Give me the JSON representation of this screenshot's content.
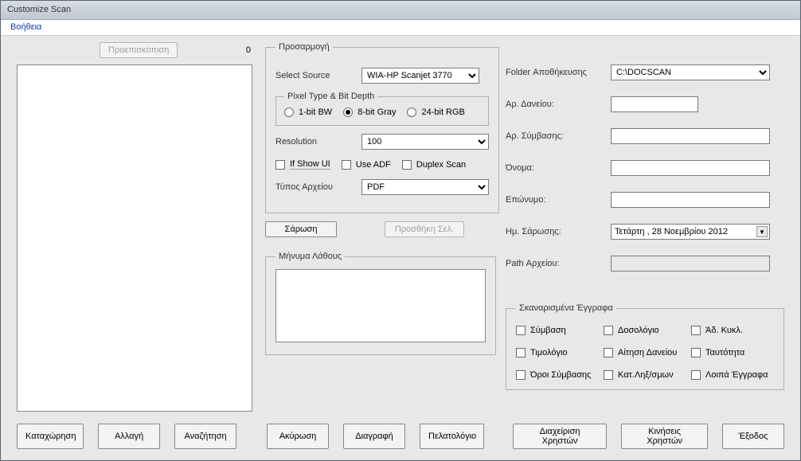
{
  "window": {
    "title": "Customize Scan"
  },
  "menu": {
    "help": "Βοήθεια"
  },
  "left": {
    "preview_btn": "Προεπισκόπιση",
    "page_count": "0"
  },
  "adjust": {
    "legend": "Προσαρμογή",
    "select_source_label": "Select Source",
    "select_source_value": "WIA-HP Scanjet 3770",
    "pixel_legend": "Pixel Type & Bit Depth",
    "radio_bw": "1-bit BW",
    "radio_gray": "8-bit Gray",
    "radio_rgb": "24-bit RGB",
    "resolution_label": "Resolution",
    "resolution_value": "100",
    "if_show_ui": "If Show UI",
    "use_adf": "Use ADF",
    "duplex": "Duplex Scan",
    "file_type_label": "Τύπος Αρχείου",
    "file_type_value": "PDF"
  },
  "actions": {
    "scan": "Σάρωση",
    "add_page": "Προσθήκη Σελ."
  },
  "error_msg": {
    "legend": "Μήνυμα Λάθους"
  },
  "right_form": {
    "folder_label": "Folder Αποθήκευσης",
    "folder_value": "C:\\DOCSCAN",
    "loan_no_label": "Αρ. Δανείου:",
    "contract_no_label": "Αρ. Σύμβασης:",
    "first_name_label": "Όνομα:",
    "last_name_label": "Επώνυμο:",
    "scan_date_label": "Ημ. Σάρωσης:",
    "scan_date_value": "Τετάρτη , 28  Νοεμβρίου  2012",
    "file_path_label": "Path Αρχείου:"
  },
  "scanned_docs": {
    "legend": "Σκαναρισμένα Έγγραφα",
    "items": {
      "0": "Σύμβαση",
      "1": "Δοσολόγιο",
      "2": "Άδ. Κυκλ.",
      "3": "Τιμολόγιο",
      "4": "Αίτηση Δανείου",
      "5": "Ταυτότητα",
      "6": "Όροι Σύμβασης",
      "7": "Κατ.Ληξ/σμων",
      "8": "Λοιπά Έγγραφα"
    }
  },
  "bottom": {
    "register": "Καταχώρηση",
    "change": "Αλλαγή",
    "search": "Αναζήτηση",
    "cancel": "Ακύρωση",
    "delete": "Διαγραφή",
    "customers": "Πελατολόγιο",
    "user_mgmt": "Διαχείριση Χρηστών",
    "user_moves": "Κινήσεις Χρηστών",
    "exit": "Έξοδος"
  }
}
